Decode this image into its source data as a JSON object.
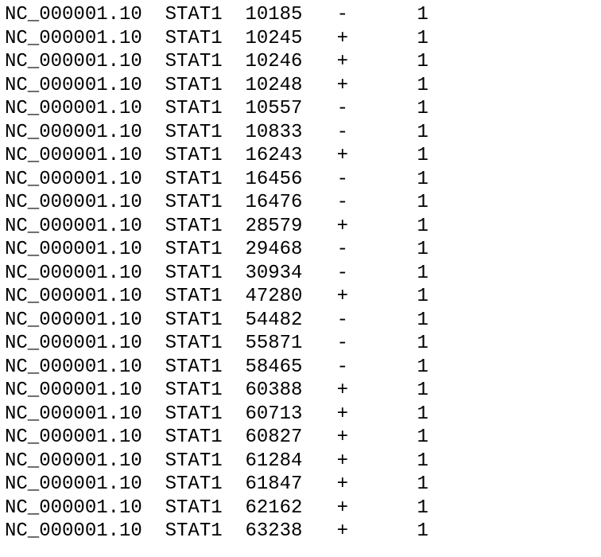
{
  "rows": [
    {
      "chrom": "NC_000001.10",
      "name": "STAT1",
      "pos": "10185",
      "strand": "-",
      "val": "1"
    },
    {
      "chrom": "NC_000001.10",
      "name": "STAT1",
      "pos": "10245",
      "strand": "+",
      "val": "1"
    },
    {
      "chrom": "NC_000001.10",
      "name": "STAT1",
      "pos": "10246",
      "strand": "+",
      "val": "1"
    },
    {
      "chrom": "NC_000001.10",
      "name": "STAT1",
      "pos": "10248",
      "strand": "+",
      "val": "1"
    },
    {
      "chrom": "NC_000001.10",
      "name": "STAT1",
      "pos": "10557",
      "strand": "-",
      "val": "1"
    },
    {
      "chrom": "NC_000001.10",
      "name": "STAT1",
      "pos": "10833",
      "strand": "-",
      "val": "1"
    },
    {
      "chrom": "NC_000001.10",
      "name": "STAT1",
      "pos": "16243",
      "strand": "+",
      "val": "1"
    },
    {
      "chrom": "NC_000001.10",
      "name": "STAT1",
      "pos": "16456",
      "strand": "-",
      "val": "1"
    },
    {
      "chrom": "NC_000001.10",
      "name": "STAT1",
      "pos": "16476",
      "strand": "-",
      "val": "1"
    },
    {
      "chrom": "NC_000001.10",
      "name": "STAT1",
      "pos": "28579",
      "strand": "+",
      "val": "1"
    },
    {
      "chrom": "NC_000001.10",
      "name": "STAT1",
      "pos": "29468",
      "strand": "-",
      "val": "1"
    },
    {
      "chrom": "NC_000001.10",
      "name": "STAT1",
      "pos": "30934",
      "strand": "-",
      "val": "1"
    },
    {
      "chrom": "NC_000001.10",
      "name": "STAT1",
      "pos": "47280",
      "strand": "+",
      "val": "1"
    },
    {
      "chrom": "NC_000001.10",
      "name": "STAT1",
      "pos": "54482",
      "strand": "-",
      "val": "1"
    },
    {
      "chrom": "NC_000001.10",
      "name": "STAT1",
      "pos": "55871",
      "strand": "-",
      "val": "1"
    },
    {
      "chrom": "NC_000001.10",
      "name": "STAT1",
      "pos": "58465",
      "strand": "-",
      "val": "1"
    },
    {
      "chrom": "NC_000001.10",
      "name": "STAT1",
      "pos": "60388",
      "strand": "+",
      "val": "1"
    },
    {
      "chrom": "NC_000001.10",
      "name": "STAT1",
      "pos": "60713",
      "strand": "+",
      "val": "1"
    },
    {
      "chrom": "NC_000001.10",
      "name": "STAT1",
      "pos": "60827",
      "strand": "+",
      "val": "1"
    },
    {
      "chrom": "NC_000001.10",
      "name": "STAT1",
      "pos": "61284",
      "strand": "+",
      "val": "1"
    },
    {
      "chrom": "NC_000001.10",
      "name": "STAT1",
      "pos": "61847",
      "strand": "+",
      "val": "1"
    },
    {
      "chrom": "NC_000001.10",
      "name": "STAT1",
      "pos": "62162",
      "strand": "+",
      "val": "1"
    },
    {
      "chrom": "NC_000001.10",
      "name": "STAT1",
      "pos": "63238",
      "strand": "+",
      "val": "1"
    }
  ]
}
